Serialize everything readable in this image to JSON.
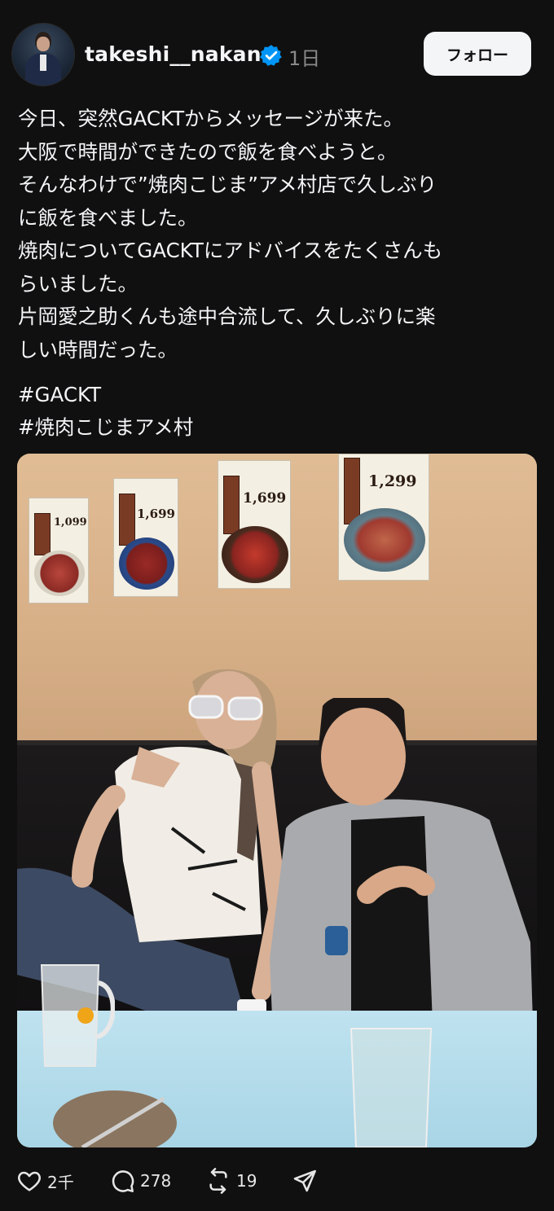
{
  "post": {
    "username": "takeshi__nakano",
    "verified": true,
    "time": "1日",
    "follow_label": "フォロー",
    "text": "今日、突然GACKTからメッセージが来た。\n大阪で時間ができたので飯を食べようと。\nそんなわけで”焼肉こじま”アメ村店で久しぶり\nに飯を食べました。\n焼肉についてGACKTにアドバイスをたくさんも\nらいました。\n片岡愛之助くんも途中合流して、久しぶりに楽\nしい時間だった。",
    "hashtags": [
      "#GACKT",
      "#焼肉こじまアメ村"
    ]
  },
  "photo": {
    "menu_prices": [
      "1,099",
      "1,699",
      "1,699",
      "1,299"
    ]
  },
  "actions": {
    "like_count": "2千",
    "comment_count": "278",
    "repost_count": "19"
  },
  "colors": {
    "background": "#101010",
    "text": "#f3f5f7",
    "muted": "#8a8a8a",
    "verified": "#0095f6"
  }
}
